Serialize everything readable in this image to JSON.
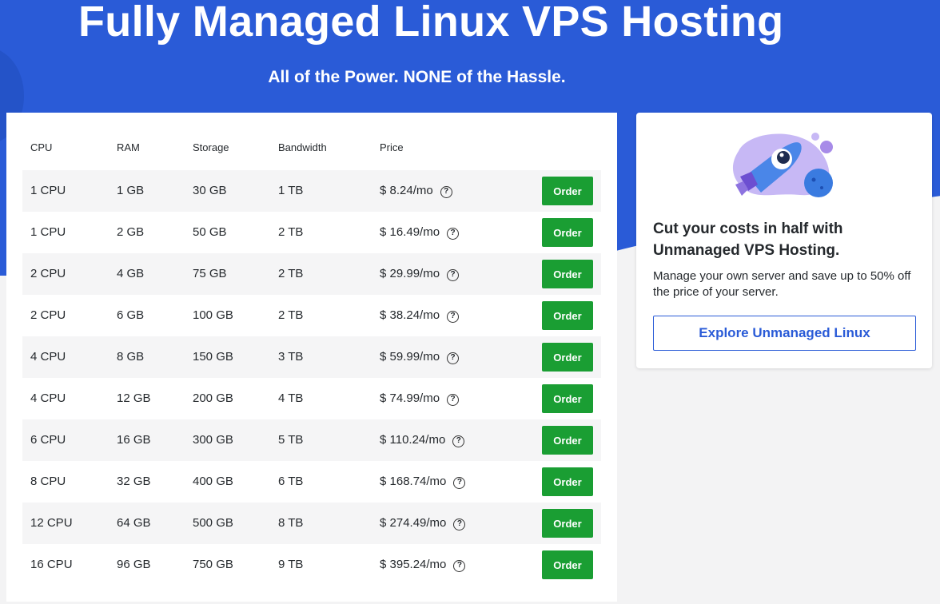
{
  "hero": {
    "title": "Fully Managed Linux VPS Hosting",
    "subtitle": "All of the Power. NONE of the Hassle."
  },
  "table": {
    "headers": [
      "CPU",
      "RAM",
      "Storage",
      "Bandwidth",
      "Price"
    ],
    "order_label": "Order",
    "help_glyph": "?",
    "rows": [
      {
        "cpu": "1 CPU",
        "ram": "1 GB",
        "storage": "30 GB",
        "bandwidth": "1 TB",
        "price": "$ 8.24/mo"
      },
      {
        "cpu": "1 CPU",
        "ram": "2 GB",
        "storage": "50 GB",
        "bandwidth": "2 TB",
        "price": "$ 16.49/mo"
      },
      {
        "cpu": "2 CPU",
        "ram": "4 GB",
        "storage": "75 GB",
        "bandwidth": "2 TB",
        "price": "$ 29.99/mo"
      },
      {
        "cpu": "2 CPU",
        "ram": "6 GB",
        "storage": "100 GB",
        "bandwidth": "2 TB",
        "price": "$ 38.24/mo"
      },
      {
        "cpu": "4 CPU",
        "ram": "8 GB",
        "storage": "150 GB",
        "bandwidth": "3 TB",
        "price": "$ 59.99/mo"
      },
      {
        "cpu": "4 CPU",
        "ram": "12 GB",
        "storage": "200 GB",
        "bandwidth": "4 TB",
        "price": "$ 74.99/mo"
      },
      {
        "cpu": "6 CPU",
        "ram": "16 GB",
        "storage": "300 GB",
        "bandwidth": "5 TB",
        "price": "$ 110.24/mo"
      },
      {
        "cpu": "8 CPU",
        "ram": "32 GB",
        "storage": "400 GB",
        "bandwidth": "6 TB",
        "price": "$ 168.74/mo"
      },
      {
        "cpu": "12 CPU",
        "ram": "64 GB",
        "storage": "500 GB",
        "bandwidth": "8 TB",
        "price": "$ 274.49/mo"
      },
      {
        "cpu": "16 CPU",
        "ram": "96 GB",
        "storage": "750 GB",
        "bandwidth": "9 TB",
        "price": "$ 395.24/mo"
      }
    ]
  },
  "promo": {
    "heading": "Cut your costs in half with Unmanaged VPS Hosting.",
    "text": "Manage your own server and save up to 50% off the price of your server.",
    "button_label": "Explore Unmanaged Linux",
    "illustration": "rocket-illustration"
  },
  "colors": {
    "hero_blue": "#2a5bd7",
    "order_green": "#1a9e33",
    "link_blue": "#2a5bd7"
  }
}
